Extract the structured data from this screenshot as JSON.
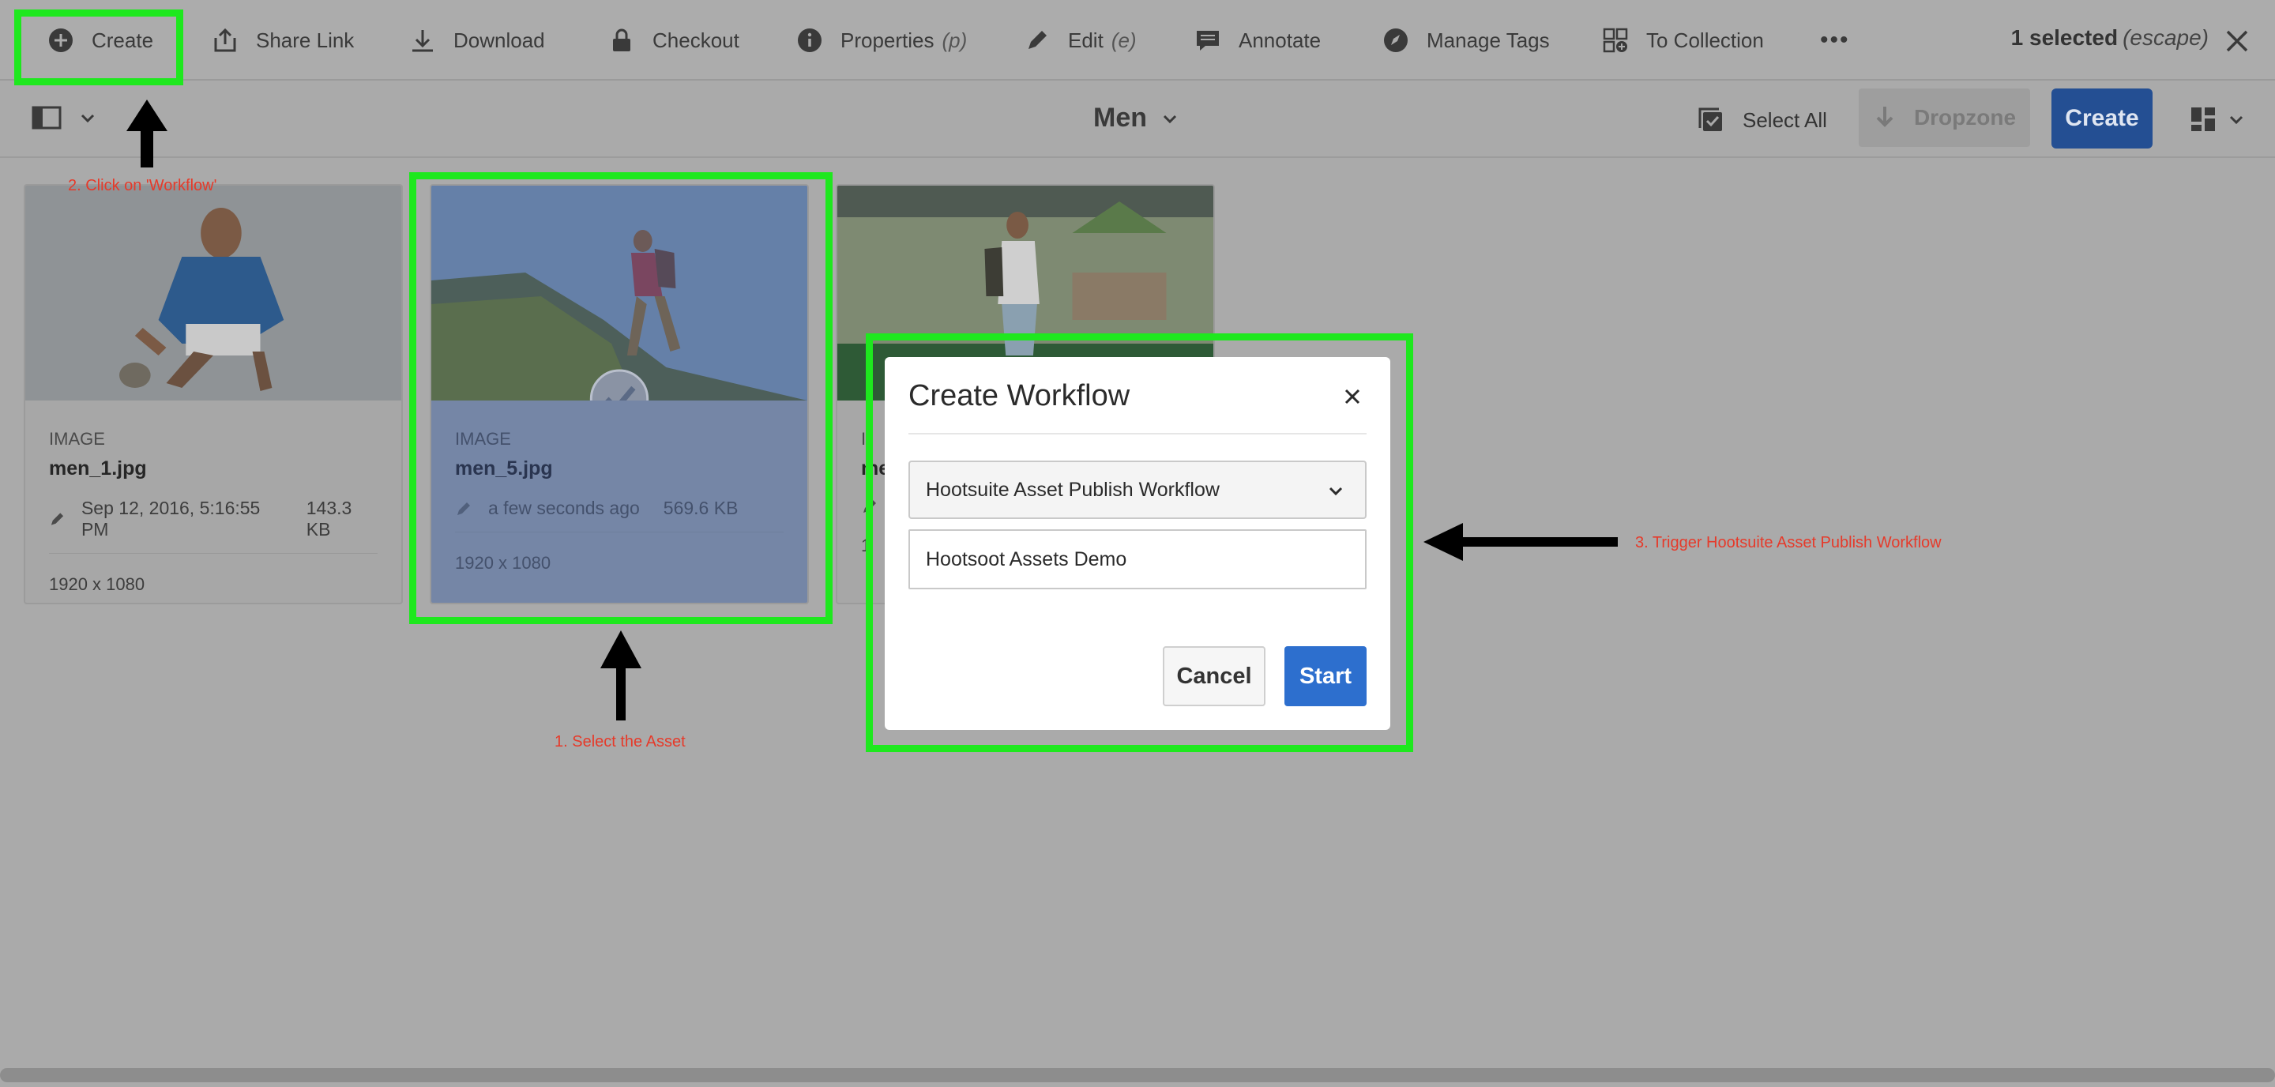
{
  "toolbar": {
    "create": "Create",
    "share_link": "Share Link",
    "download": "Download",
    "checkout": "Checkout",
    "properties": "Properties",
    "properties_shortcut": "(p)",
    "edit": "Edit",
    "edit_shortcut": "(e)",
    "annotate": "Annotate",
    "manage_tags": "Manage Tags",
    "to_collection": "To Collection",
    "more": "•••",
    "selection_count": "1 selected",
    "selection_hint": "(escape)"
  },
  "subbar": {
    "folder": "Men",
    "select_all": "Select All",
    "dropzone": "Dropzone",
    "create": "Create"
  },
  "cards": [
    {
      "kind": "IMAGE",
      "name": "men_1.jpg",
      "modified": "Sep 12, 2016, 5:16:55 PM",
      "size": "143.3 KB",
      "dims": "1920 x 1080"
    },
    {
      "kind": "IMAGE",
      "name": "men_5.jpg",
      "modified": "a few seconds ago",
      "size": "569.6 KB",
      "dims": "1920 x 1080"
    },
    {
      "kind": "I",
      "name": "me",
      "modified": "",
      "size": "",
      "dims": "1"
    }
  ],
  "dialog": {
    "title": "Create Workflow",
    "workflow_selected": "Hootsuite Asset Publish Workflow",
    "title_value": "Hootsoot Assets Demo",
    "cancel": "Cancel",
    "start": "Start"
  },
  "annotations": {
    "step1": "1. Select the Asset",
    "step2": "2. Click on 'Workflow'",
    "step3": "3. Trigger Hootsuite Asset Publish Workflow"
  },
  "colors": {
    "highlight": "#1ee81e",
    "primary_button": "#2d6fce",
    "annotation_text": "#e63a2a"
  }
}
